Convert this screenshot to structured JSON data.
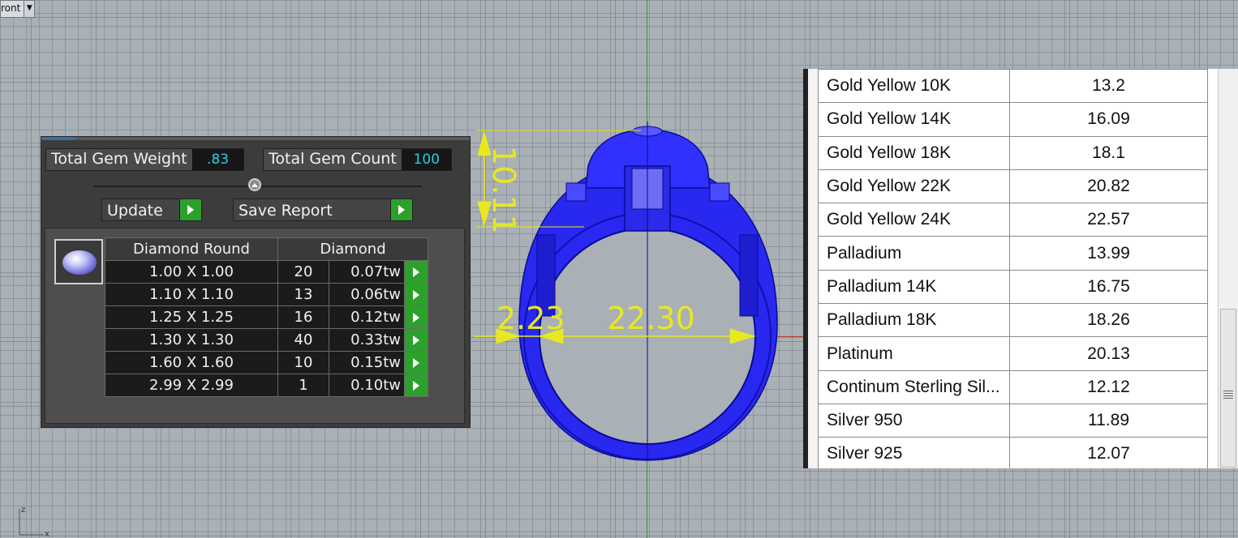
{
  "viewport": {
    "name": "ront"
  },
  "gem_panel": {
    "total_gem_weight_label": "Total Gem Weight",
    "total_gem_weight": ".83",
    "total_gem_count_label": "Total Gem Count",
    "total_gem_count": "100",
    "update_label": "Update",
    "save_report_label": "Save Report",
    "table_header": {
      "shape": "Diamond Round",
      "material": "Diamond"
    },
    "rows": [
      {
        "size": "1.00 X 1.00",
        "count": "20",
        "weight": "0.07tw"
      },
      {
        "size": "1.10 X 1.10",
        "count": "13",
        "weight": "0.06tw"
      },
      {
        "size": "1.25 X 1.25",
        "count": "16",
        "weight": "0.12tw"
      },
      {
        "size": "1.30 X 1.30",
        "count": "40",
        "weight": "0.33tw"
      },
      {
        "size": "1.60 X 1.60",
        "count": "10",
        "weight": "0.15tw"
      },
      {
        "size": "2.99 X 2.99",
        "count": "1",
        "weight": "0.10tw"
      }
    ]
  },
  "dimensions": {
    "height": "10.11",
    "band": "2.23",
    "inner_diameter": "22.30"
  },
  "metals": [
    {
      "name": "Gold Yellow 10K",
      "value": "13.2"
    },
    {
      "name": "Gold Yellow 14K",
      "value": "16.09"
    },
    {
      "name": "Gold Yellow 18K",
      "value": "18.1"
    },
    {
      "name": "Gold Yellow 22K",
      "value": "20.82"
    },
    {
      "name": "Gold Yellow 24K",
      "value": "22.57"
    },
    {
      "name": "Palladium",
      "value": "13.99"
    },
    {
      "name": "Palladium 14K",
      "value": "16.75"
    },
    {
      "name": "Palladium 18K",
      "value": "18.26"
    },
    {
      "name": "Platinum",
      "value": "20.13"
    },
    {
      "name": "Continum Sterling Sil...",
      "value": "12.12"
    },
    {
      "name": "Silver 950",
      "value": "11.89"
    },
    {
      "name": "Silver 925",
      "value": "12.07"
    }
  ],
  "axis_labels": {
    "z": "z",
    "x": "x"
  },
  "colors": {
    "ring": "#2828f0",
    "dimension": "#e8e820",
    "accent_green": "#2ba12b",
    "value_cyan": "#29d0e6"
  }
}
